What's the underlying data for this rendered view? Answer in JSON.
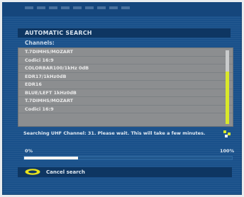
{
  "dialog": {
    "title": "AUTOMATIC SEARCH",
    "channels_label": "Channels:"
  },
  "channels": [
    "T.7DIMHS/MOZART",
    "Codici 16:9",
    "COLORBAR100/1kHz 0dB",
    "EDR17/1kHz0dB",
    "EDR16",
    "BLUE/LEFT 1kHz0dB",
    "T.7DIMHS/MOZART",
    "Codici 16:9"
  ],
  "scrollbar": {
    "position": 0.3
  },
  "status": {
    "text": "Searching UHF Channel: 31. Please wait. This will take a few minutes."
  },
  "progress": {
    "start_label": "0%",
    "end_label": "100%",
    "value": 0.26
  },
  "footer": {
    "cancel_label": "Cancel search",
    "button_color": "#e8e21c"
  },
  "colors": {
    "background": "#19508a",
    "header": "#0e3662",
    "list_bg": "#8c8e90",
    "scroll_accent": "#d9e82a"
  }
}
